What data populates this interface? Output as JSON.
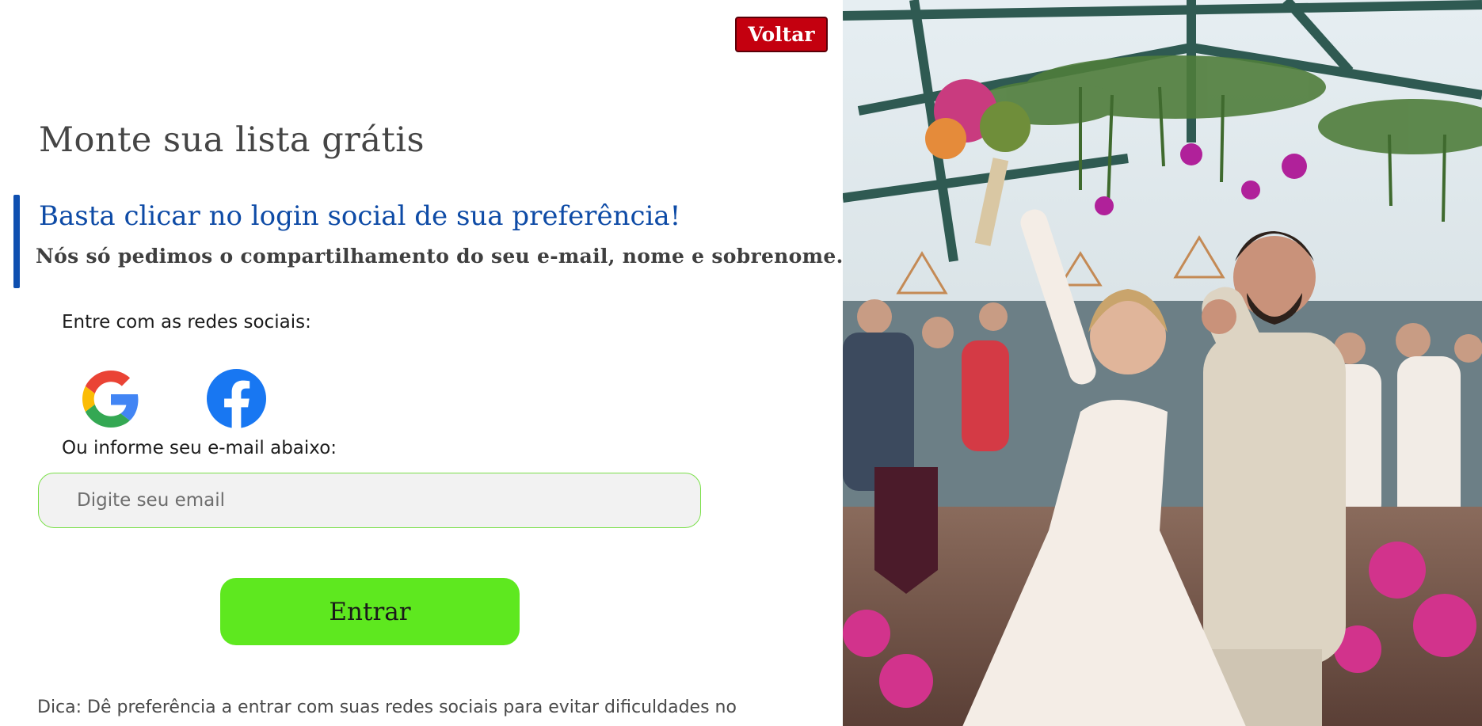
{
  "header": {
    "back_label": "Voltar"
  },
  "main": {
    "title": "Monte sua lista grátis",
    "subtitle": "Basta clicar no login social de sua preferência!",
    "subtext": "Nós só pedimos o compartilhamento do seu e-mail, nome e sobrenome.",
    "social_label": "Entre com as redes sociais:",
    "social_buttons": [
      {
        "icon": "google-icon"
      },
      {
        "icon": "facebook-icon"
      }
    ],
    "email_label": "Ou informe seu e-mail abaixo:",
    "email": {
      "placeholder": "Digite seu email",
      "value": ""
    },
    "submit_label": "Entrar",
    "tip": "Dica: Dê preferência a entrar com suas redes sociais para evitar dificuldades no"
  },
  "colors": {
    "back_button": "#c4000f",
    "title": "#454545",
    "subtitle": "#0e4ba6",
    "accent_bar": "#0e4fb0",
    "input_border": "#7be04a",
    "submit_button": "#5ee81f"
  }
}
